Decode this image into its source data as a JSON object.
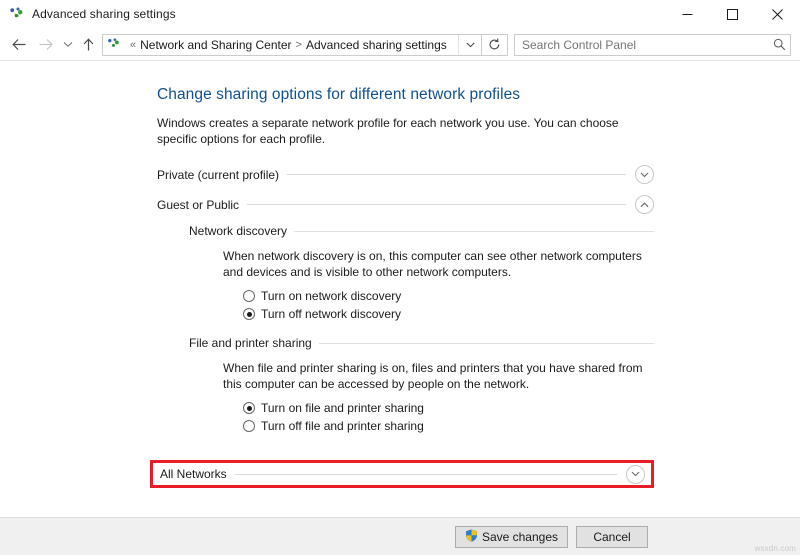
{
  "window": {
    "title": "Advanced sharing settings",
    "icon": "network-sharing-icon",
    "minimize_label": "Minimize",
    "maximize_label": "Maximize",
    "close_label": "Close"
  },
  "navbar": {
    "back_label": "Back",
    "forward_label": "Forward",
    "recent_label": "Recent locations",
    "up_label": "Up",
    "breadcrumb": {
      "overflow": "«",
      "separator": ">",
      "items": [
        "Network and Sharing Center",
        "Advanced sharing settings"
      ]
    },
    "dropdown_label": "Previous locations",
    "refresh_label": "Refresh",
    "search": {
      "placeholder": "Search Control Panel",
      "value": ""
    }
  },
  "page": {
    "title": "Change sharing options for different network profiles",
    "description": "Windows creates a separate network profile for each network you use. You can choose specific options for each profile."
  },
  "profiles": [
    {
      "label": "Private (current profile)",
      "expanded": false,
      "chevron": "chevron-down-icon"
    },
    {
      "label": "Guest or Public",
      "expanded": true,
      "chevron": "chevron-up-icon"
    }
  ],
  "guest_or_public": {
    "sections": [
      {
        "heading": "Network discovery",
        "description": "When network discovery is on, this computer can see other network computers and devices and is visible to other network computers.",
        "options": [
          {
            "label": "Turn on network discovery",
            "selected": false
          },
          {
            "label": "Turn off network discovery",
            "selected": true
          }
        ]
      },
      {
        "heading": "File and printer sharing",
        "description": "When file and printer sharing is on, files and printers that you have shared from this computer can be accessed by people on the network.",
        "options": [
          {
            "label": "Turn on file and printer sharing",
            "selected": true
          },
          {
            "label": "Turn off file and printer sharing",
            "selected": false
          }
        ]
      }
    ]
  },
  "all_networks": {
    "label": "All Networks",
    "expanded": false,
    "chevron": "chevron-down-icon",
    "highlight_color": "#e81d28"
  },
  "footer": {
    "save_label": "Save changes",
    "save_icon": "uac-shield-icon",
    "cancel_label": "Cancel"
  },
  "watermark": "wsxdn.com"
}
